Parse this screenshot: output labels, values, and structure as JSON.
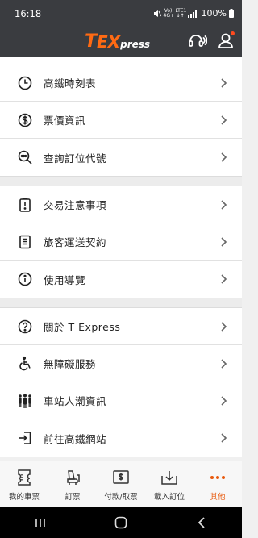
{
  "status": {
    "time": "16:18",
    "net_top": "Vo) 4G+",
    "net_bottom": "LTE1 ↓↑",
    "battery": "100%"
  },
  "app": {
    "logo_t": "T",
    "logo_e": "EX",
    "logo_rest": "press",
    "accent": "#ff6a13"
  },
  "groups": [
    [
      {
        "label": "高鐵時刻表",
        "icon": "clock-icon"
      },
      {
        "label": "票價資訊",
        "icon": "dollar-circle-icon"
      },
      {
        "label": "查詢訂位代號",
        "icon": "magnifier-icon"
      }
    ],
    [
      {
        "label": "交易注意事項",
        "icon": "clipboard-icon"
      },
      {
        "label": "旅客運送契約",
        "icon": "document-icon"
      },
      {
        "label": "使用導覽",
        "icon": "info-icon"
      }
    ],
    [
      {
        "label": "關於 T Express",
        "icon": "question-icon"
      },
      {
        "label": "無障礙服務",
        "icon": "wheelchair-icon"
      },
      {
        "label": "車站人潮資訊",
        "icon": "crowd-icon"
      },
      {
        "label": "前往高鐵網站",
        "icon": "external-link-icon"
      }
    ]
  ],
  "tabs": [
    {
      "label": "我的車票",
      "icon": "ticket-icon"
    },
    {
      "label": "訂票",
      "icon": "seat-icon"
    },
    {
      "label": "付款/取票",
      "icon": "payment-icon"
    },
    {
      "label": "載入訂位",
      "icon": "download-icon"
    },
    {
      "label": "其他",
      "icon": "more-icon",
      "active": true
    }
  ]
}
